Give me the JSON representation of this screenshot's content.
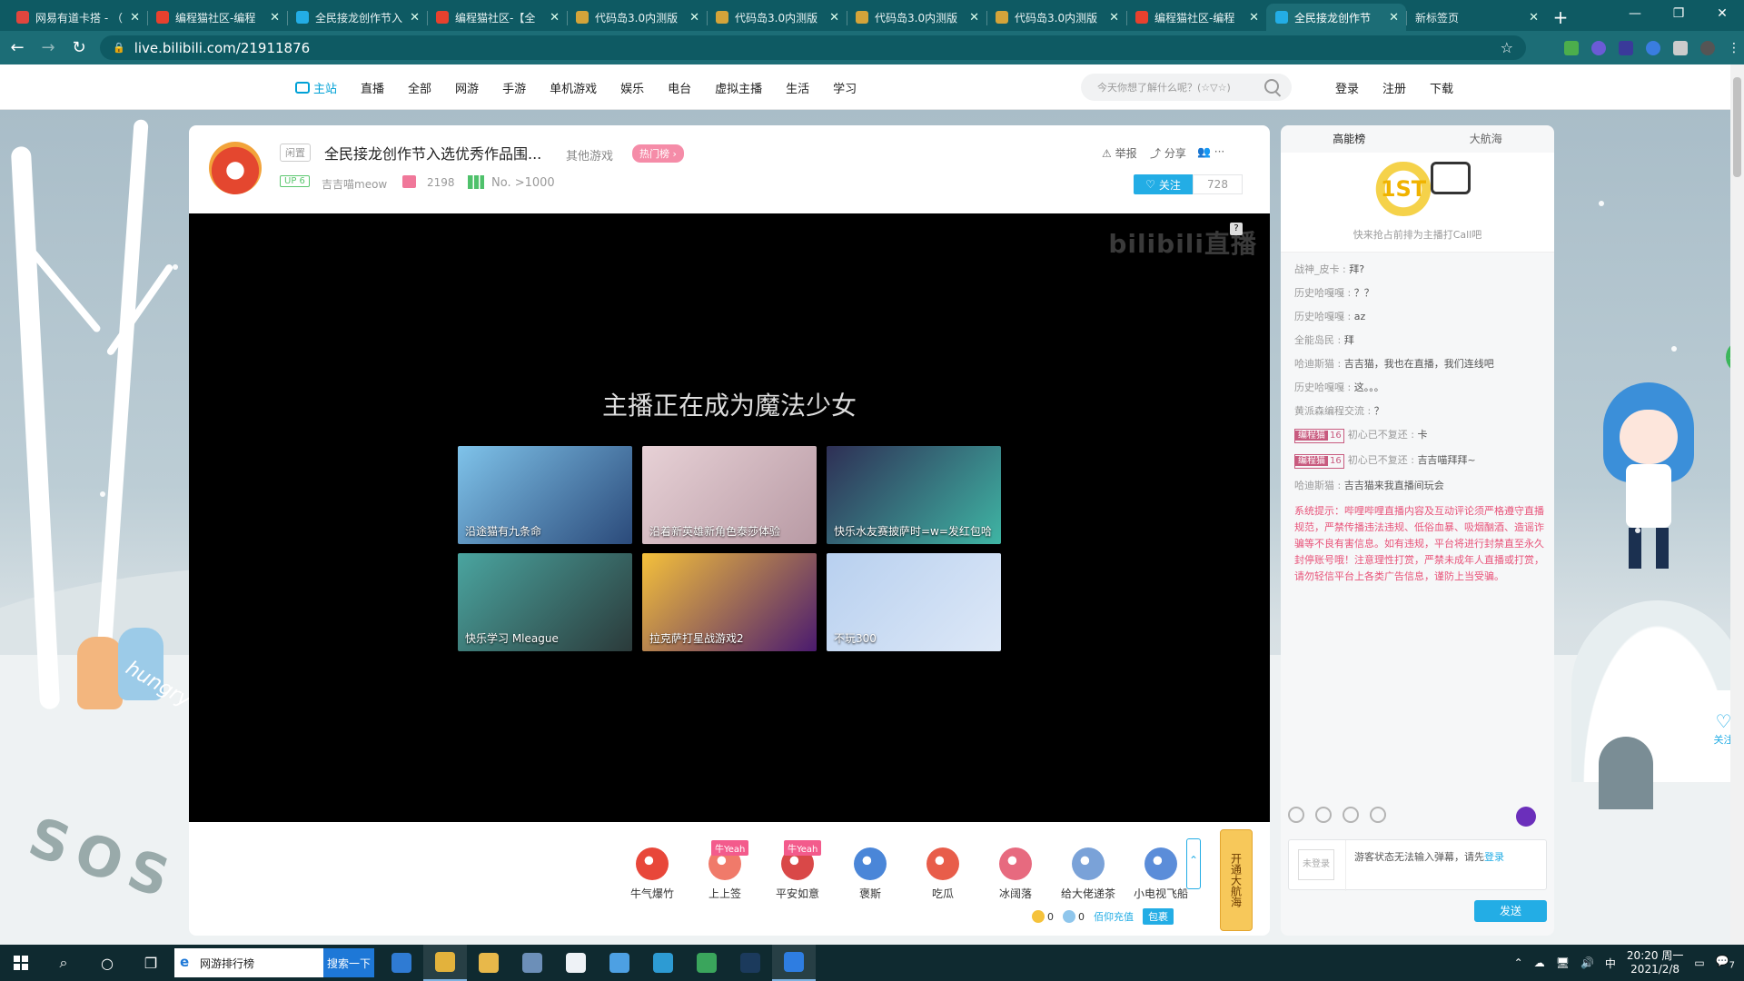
{
  "browser": {
    "tabs": [
      {
        "title": "网易有道卡搭 - （",
        "favicon_color": "#e0463e",
        "active": false
      },
      {
        "title": "编程猫社区-编程",
        "favicon_color": "#e7412e",
        "active": false
      },
      {
        "title": "全民接龙创作节入",
        "favicon_color": "#23ade5",
        "active": false
      },
      {
        "title": "编程猫社区-【全",
        "favicon_color": "#e7412e",
        "active": false
      },
      {
        "title": "代码岛3.0内测版",
        "favicon_color": "#d4a43a",
        "active": false
      },
      {
        "title": "代码岛3.0内测版",
        "favicon_color": "#d4a43a",
        "active": false
      },
      {
        "title": "代码岛3.0内测版",
        "favicon_color": "#d4a43a",
        "active": false
      },
      {
        "title": "代码岛3.0内测版",
        "favicon_color": "#d4a43a",
        "active": false
      },
      {
        "title": "编程猫社区-编程",
        "favicon_color": "#e7412e",
        "active": false
      },
      {
        "title": "全民接龙创作节",
        "favicon_color": "#23ade5",
        "active": true
      },
      {
        "title": "新标签页",
        "favicon_color": "",
        "active": false
      }
    ],
    "url": "live.bilibili.com/21911876",
    "window_controls": [
      "—",
      "❐",
      "✕"
    ]
  },
  "site_nav": {
    "items": [
      "主站",
      "直播",
      "全部",
      "网游",
      "手游",
      "单机游戏",
      "娱乐",
      "电台",
      "虚拟主播",
      "生活",
      "学习"
    ],
    "search_placeholder": "今天你想了解什么呢？(☆▽☆)",
    "user_links": [
      "登录",
      "注册",
      "下载"
    ]
  },
  "room": {
    "area_tag": "闲置",
    "title": "全民接龙创作节入选优秀作品围...",
    "sub_area": "其他游戏",
    "hot_rank_label": "热门榜 ›",
    "up_level": "UP 6",
    "up_name": "吉吉喵meow",
    "gift_count": "2198",
    "rank_text": "No. >1000",
    "report_label": "举报",
    "share_label": "分享",
    "more_label": "···",
    "follow_label": "关注",
    "fans_count": "728"
  },
  "player": {
    "watermark": "bilibili直播",
    "watermark_q": "?",
    "offline_message": "主播正在成为魔法少女",
    "recommendations": [
      {
        "label": "沿途猫有九条命",
        "color_a": "#7fc3ea",
        "color_b": "#2b4a7a"
      },
      {
        "label": "沿着新英雄新角色泰莎体验",
        "color_a": "#e7d1d6",
        "color_b": "#b89aa4"
      },
      {
        "label": "快乐水友赛披萨时=w=发红包哈",
        "color_a": "#2e2f55",
        "color_b": "#3fb5a4"
      },
      {
        "label": "快乐学习 Mleague",
        "color_a": "#4aa5a0",
        "color_b": "#2b3a3a"
      },
      {
        "label": "拉克萨打星战游戏2",
        "color_a": "#f5c13b",
        "color_b": "#4a1a6f"
      },
      {
        "label": "不玩300",
        "color_a": "#b8d0ef",
        "color_b": "#dde8f7"
      }
    ]
  },
  "gifts": [
    {
      "name": "牛气爆竹",
      "badge": "",
      "color": "#e8473a"
    },
    {
      "name": "上上签",
      "badge": "牛Yeah",
      "color": "#f07a6a"
    },
    {
      "name": "平安如意",
      "badge": "牛Yeah",
      "color": "#d94848"
    },
    {
      "name": "褒斯",
      "badge": "",
      "color": "#4a86d8"
    },
    {
      "name": "吃瓜",
      "badge": "",
      "color": "#e85d4a"
    },
    {
      "name": "冰阔落",
      "badge": "",
      "color": "#e76a7f"
    },
    {
      "name": "给大佬递茶",
      "badge": "",
      "color": "#7aa2d8"
    },
    {
      "name": "小电视飞船",
      "badge": "",
      "color": "#5b8dd9"
    }
  ],
  "gift_bar": {
    "expand_label": "⌃",
    "captain_label": "开通大航海",
    "gold_count": "0",
    "silver_count": "0",
    "recharge_label": "佰仰充值",
    "package_label": "包裹"
  },
  "side": {
    "tabs": [
      "高能榜",
      "大航海"
    ],
    "rank_badge": "1ST",
    "rank_tip": "快来抢占前排为主播打Call吧",
    "messages": [
      {
        "user": "战神_皮卡",
        "text": "拜?",
        "medal": null
      },
      {
        "user": "历史哈嘎嘎",
        "text": "？？",
        "medal": null
      },
      {
        "user": "历史哈嘎嘎",
        "text": "az",
        "medal": null
      },
      {
        "user": "全能岛民",
        "text": "拜",
        "medal": null
      },
      {
        "user": "哈迪斯猫",
        "text": "吉吉猫，我也在直播，我们连线吧",
        "medal": null
      },
      {
        "user": "历史哈嘎嘎",
        "text": "这。。。",
        "medal": null
      },
      {
        "user": "黄派森编程交流",
        "text": "？",
        "medal": null
      },
      {
        "user": "初心已不复还",
        "text": "卡",
        "medal": {
          "name": "编程猫",
          "level": "16"
        }
      },
      {
        "user": "初心已不复还",
        "text": "吉吉喵拜拜~",
        "medal": {
          "name": "编程猫",
          "level": "16"
        }
      },
      {
        "user": "哈迪斯猫",
        "text": "吉吉猫来我直播间玩会",
        "medal": null
      }
    ],
    "system_notice": "系统提示：哔哩哔哩直播内容及互动评论须严格遵守直播规范，严禁传播违法违规、低俗血暴、吸烟酗酒、造谣诈骗等不良有害信息。如有违规，平台将进行封禁直至永久封停账号哦！注意理性打赏，严禁未成年人直播或打赏，请勿轻信平台上各类广告信息，谨防上当受骗。",
    "not_logged_label": "未登录",
    "input_placeholder": "游客状态无法输入弹幕，请先",
    "login_link": "登录",
    "send_label": "发送"
  },
  "scene": {
    "hungry_text": "hungry",
    "sos_text": "SOS",
    "float_follow_label": "关注",
    "edge_badge": "35"
  },
  "taskbar": {
    "search_text": "网游排行榜",
    "search_button": "搜索一下",
    "apps": [
      {
        "name": "mail",
        "color": "#2f7bd3",
        "running": false
      },
      {
        "name": "chrome",
        "color": "#e3b23c",
        "running": true
      },
      {
        "name": "explorer",
        "color": "#e8b84a",
        "running": false
      },
      {
        "name": "store",
        "color": "#6c8fb8",
        "running": false
      },
      {
        "name": "notepad",
        "color": "#eef2f6",
        "running": false
      },
      {
        "name": "app-blue",
        "color": "#4da0e3",
        "running": false
      },
      {
        "name": "edge",
        "color": "#2d9bd3",
        "running": false
      },
      {
        "name": "app-green",
        "color": "#3aa55c",
        "running": false
      },
      {
        "name": "steam",
        "color": "#1b3a5c",
        "running": false
      },
      {
        "name": "game",
        "color": "#2e7de1",
        "running": true
      }
    ],
    "ime": "中",
    "time": "20:20 周一",
    "date": "2021/2/8",
    "notification_count": "7"
  }
}
